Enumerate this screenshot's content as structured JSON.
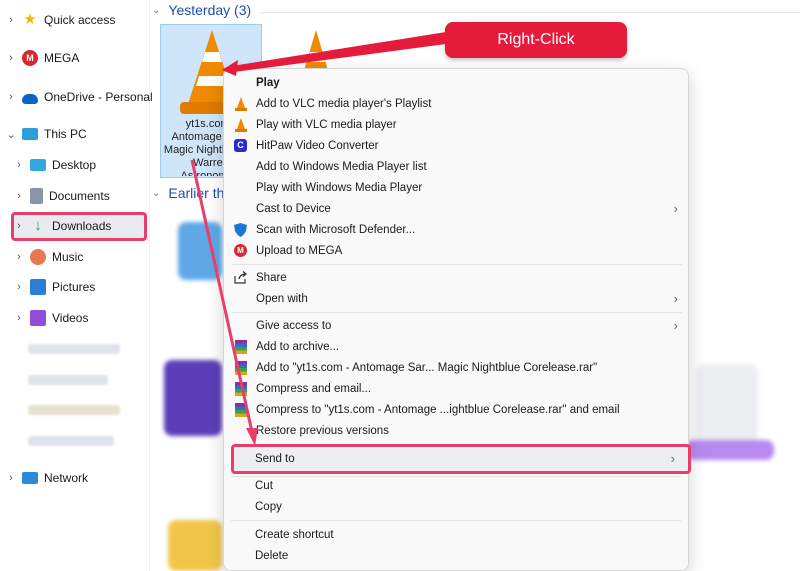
{
  "sidebar": {
    "quick_access": "Quick access",
    "mega": "MEGA",
    "onedrive": "OneDrive - Personal",
    "this_pc": "This PC",
    "desktop": "Desktop",
    "documents": "Documents",
    "downloads": "Downloads",
    "music": "Music",
    "pictures": "Pictures",
    "videos": "Videos",
    "network": "Network"
  },
  "content": {
    "group_yesterday": "Yesterday (3)",
    "group_earlier": "Earlier th",
    "file_name": "yt1s.com - Antomage Sar... Magic Nightblue de Warren Astronomy..."
  },
  "callout": {
    "label": "Right-Click"
  },
  "context_menu": {
    "play": "Play",
    "add_vlc_playlist": "Add to VLC media player's Playlist",
    "play_vlc": "Play with VLC media player",
    "hitpaw": "HitPaw Video Converter",
    "add_wmp_list": "Add to Windows Media Player list",
    "play_wmp": "Play with Windows Media Player",
    "cast": "Cast to Device",
    "defender": "Scan with Microsoft Defender...",
    "mega_upload": "Upload to MEGA",
    "share": "Share",
    "open_with": "Open with",
    "give_access": "Give access to",
    "add_archive": "Add to archive...",
    "add_rar": "Add to \"yt1s.com - Antomage  Sar...  Magic  Nightblue Corelease.rar\"",
    "compress_email": "Compress and email...",
    "compress_rar_email": "Compress to \"yt1s.com - Antomage ...ightblue Corelease.rar\" and email",
    "restore": "Restore previous versions",
    "send_to": "Send to",
    "cut": "Cut",
    "copy": "Copy",
    "create_shortcut": "Create shortcut",
    "delete": "Delete"
  },
  "colors": {
    "highlight": "#e83e6c",
    "callout": "#e51b3c",
    "vlc_orange": "#f08a00",
    "mega_red": "#d9272e",
    "accent_blue": "#1e4fa8"
  },
  "icons": {
    "vlc": "vlc-cone-icon",
    "hitpaw": "hitpaw-icon",
    "defender": "shield-icon",
    "mega": "mega-icon",
    "share": "share-icon",
    "winrar": "winrar-icon"
  }
}
